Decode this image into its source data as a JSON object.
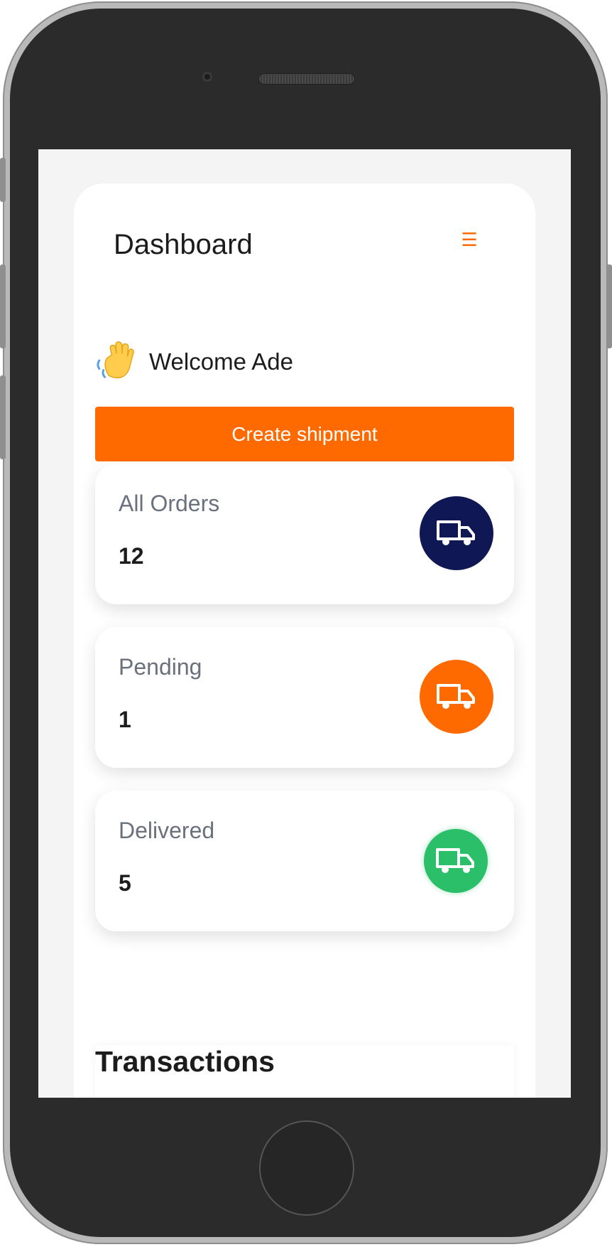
{
  "header": {
    "title": "Dashboard",
    "menu_icon": "hamburger-icon",
    "menu_glyph": "☰"
  },
  "welcome": {
    "icon": "waving-hand-icon",
    "text": "Welcome Ade"
  },
  "actions": {
    "create_label": "Create shipment"
  },
  "stats": [
    {
      "label": "All Orders",
      "value": "12",
      "icon": "truck-icon",
      "color": "#0f1854"
    },
    {
      "label": "Pending",
      "value": "1",
      "icon": "truck-icon",
      "color": "#ff6a00"
    },
    {
      "label": "Delivered",
      "value": "5",
      "icon": "truck-icon",
      "color": "#2cbf6a"
    }
  ],
  "transactions": {
    "title": "Transactions"
  },
  "colors": {
    "accent": "#ff6a00",
    "background": "#f4f4f4"
  }
}
